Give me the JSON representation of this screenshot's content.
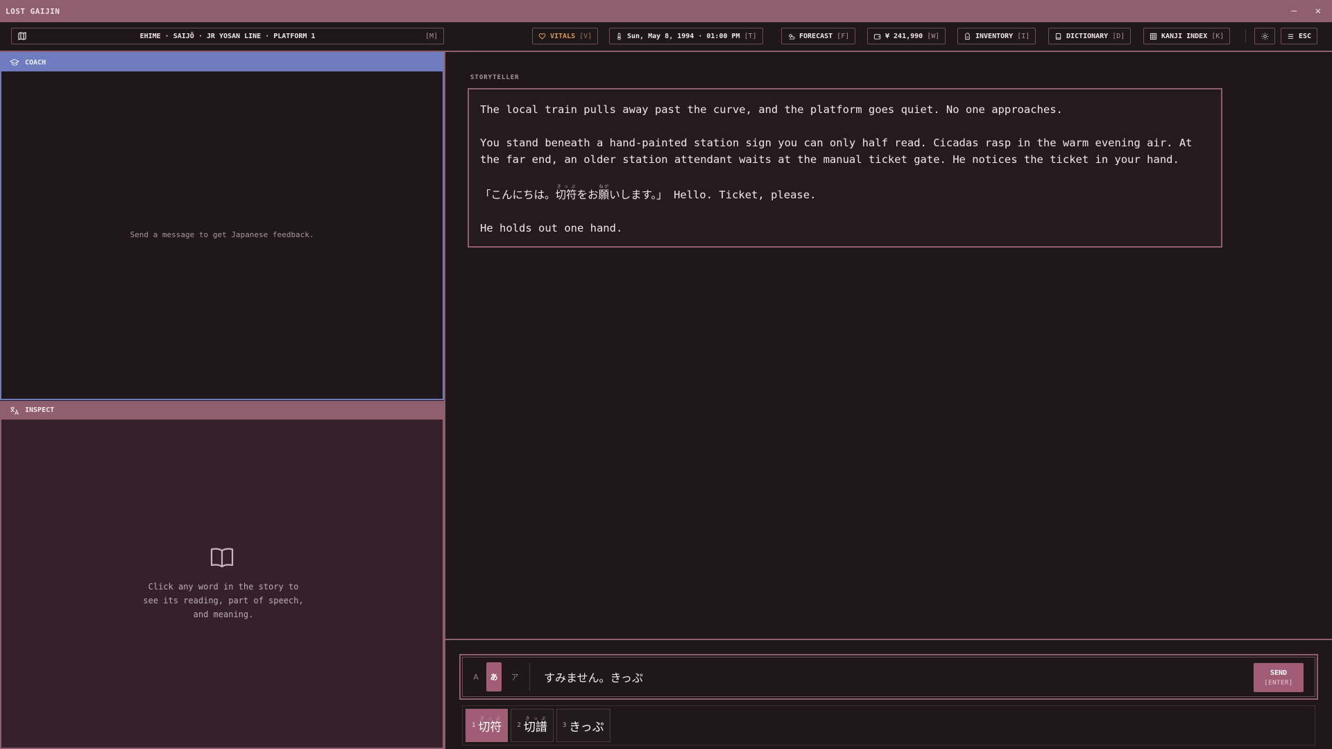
{
  "window": {
    "title": "LOST GAIJIN",
    "minimize": "—",
    "close": "✕"
  },
  "toolbar": {
    "location": {
      "text": "EHIME · SAIJŌ · JR YOSAN LINE · PLATFORM 1",
      "hotkey": "[M]"
    },
    "vitals": {
      "label": "VITALS",
      "hotkey": "[V]"
    },
    "datetime": {
      "label": "Sun, May 8, 1994 · 01:00 PM",
      "hotkey": "[T]"
    },
    "forecast": {
      "label": "FORECAST",
      "hotkey": "[F]"
    },
    "wallet": {
      "label": "¥ 241,990",
      "hotkey": "[W]"
    },
    "inventory": {
      "label": "INVENTORY",
      "hotkey": "[I]"
    },
    "dictionary": {
      "label": "DICTIONARY",
      "hotkey": "[D]"
    },
    "kanji_index": {
      "label": "KANJI INDEX",
      "hotkey": "[K]"
    },
    "menu": {
      "label": "ESC"
    }
  },
  "coach": {
    "title": "COACH",
    "empty_text": "Send a message to get Japanese feedback."
  },
  "inspect": {
    "title": "INSPECT",
    "hint_lines": [
      "Click any word in the story to",
      "see its reading, part of speech,",
      "and meaning."
    ]
  },
  "story": {
    "label": "STORYTELLER",
    "p1": "The local train pulls away past the curve, and the platform goes quiet. No one approaches.",
    "p2": "You stand beneath a hand-painted station sign you can only half read. Cicadas rasp in the warm evening air. At the far end, an older station attendant waits at the manual ticket gate. He notices the ticket in your hand.",
    "p3": {
      "open": "「こんにちは。",
      "kanji1": "切符",
      "ruby1": "きっぷ",
      "mid": "をお",
      "kanji2": "願",
      "ruby2": "ねが",
      "rest": "いします。」",
      "english": " Hello. Ticket, please."
    },
    "p4": "He holds out one hand."
  },
  "input": {
    "modes": [
      "A",
      "あ",
      "ア"
    ],
    "active_mode": "あ",
    "value": "すみません。きっぷ",
    "send_label": "SEND",
    "send_hotkey": "[ENTER]"
  },
  "candidates": [
    {
      "num": "1",
      "word": "切符",
      "reading": "きっぷ",
      "selected": true
    },
    {
      "num": "2",
      "word": "切譜",
      "reading": "きっぷ",
      "selected": false
    },
    {
      "num": "3",
      "word": "きっぷ",
      "reading": "",
      "selected": false
    }
  ],
  "colors": {
    "accent": "#8f5f6f",
    "coach": "#6f7cc0",
    "send": "#a15d75",
    "vitals": "#d49a55"
  }
}
